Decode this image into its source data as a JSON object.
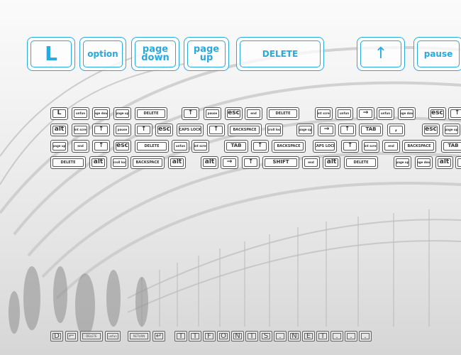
{
  "preview": {
    "large_keys": [
      {
        "label": "L",
        "kind": "letter"
      },
      {
        "label": "option",
        "kind": "word"
      },
      {
        "label": "page\ndown",
        "kind": "word"
      },
      {
        "label": "page\nup",
        "kind": "word"
      },
      {
        "label": "DELETE",
        "kind": "word"
      },
      {
        "label": "↑",
        "kind": "arrow-up"
      },
      {
        "label": "pause",
        "kind": "word"
      }
    ],
    "rows": [
      [
        "L",
        "unfun",
        "page down",
        "page up",
        "DELETE",
        "↑",
        "pause",
        "esc",
        "end",
        "DELETE",
        "print screen",
        "unfun",
        "→",
        "unfun",
        "page down",
        "esc",
        "↑"
      ],
      [
        "alt",
        "print screen",
        "↑",
        "pause",
        "↑",
        "esc",
        "CAPS LOCK",
        "↑",
        "BACKSPACE",
        "scroll lock",
        "page up",
        "→",
        "↑",
        "TAB",
        ",",
        "esc",
        "page up"
      ],
      [
        "page up",
        "end",
        "↑",
        "esc",
        "DELETE",
        "unfun",
        "print screen",
        "TAB",
        "↑",
        "BACKSPACE",
        "CAPS LOCK",
        "↑",
        "print screen",
        "end",
        "BACKSPACE",
        "TAB"
      ],
      [
        "DELETE",
        "alt",
        "scroll lock",
        "BACKSPACE",
        "alt",
        "alt",
        "→",
        "↑",
        "SHIFT",
        "end",
        "alt",
        "DELETE",
        "page up",
        "page down",
        "alt",
        ""
      ]
    ],
    "footer_keys": [
      "D",
      "⌐",
      "DELETE",
      "unfun",
      "RETURN",
      "↵"
    ],
    "watermark_chars": [
      "T",
      "T",
      "F",
      "O",
      "N",
      "T",
      "S",
      ".",
      "N",
      "E",
      "T",
      ".",
      ".",
      "."
    ]
  },
  "colors": {
    "accent": "#29a9dc",
    "small_key_border": "#555555"
  }
}
